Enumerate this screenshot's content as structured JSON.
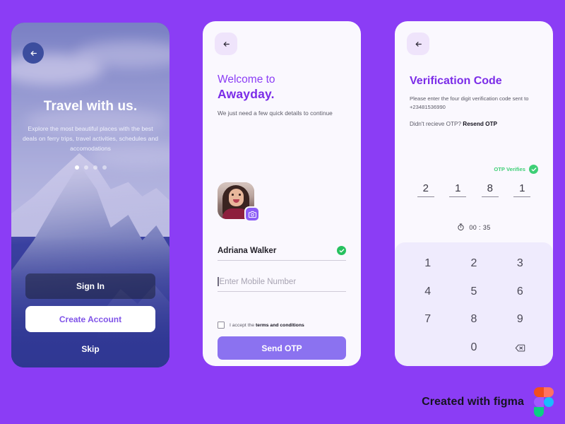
{
  "background_color": "#8B3DF5",
  "onboarding": {
    "back_icon": "arrow-left-icon",
    "title": "Travel with us.",
    "subtitle": "Explore the most beautiful places with the best deals on ferry trips, travel activities, schedules and accomodations",
    "pager": {
      "total": 4,
      "active_index": 0
    },
    "sign_in_label": "Sign In",
    "create_account_label": "Create Account",
    "skip_label": "Skip",
    "accent_create_account": "#8054E8"
  },
  "signup": {
    "back_icon": "arrow-left-icon",
    "welcome_line1": "Welcome to",
    "welcome_line2": "Awayday.",
    "note": "We just need a few quick details to continue",
    "avatar": {
      "name": "avatar",
      "camera_icon": "camera-icon"
    },
    "name_field": {
      "value": "Adriana Walker",
      "verified_icon": "check-badge-icon"
    },
    "phone_field": {
      "value": "",
      "placeholder": "Enter Mobile Number"
    },
    "terms": {
      "prefix": "I accept the ",
      "link": "terms and conditions",
      "checked": false
    },
    "submit_label": "Send OTP",
    "accent": "#8B72F0",
    "verified_color": "#27c15f"
  },
  "otp": {
    "back_icon": "arrow-left-icon",
    "title": "Verification Code",
    "instruction": "Please enter the four digit verification code sent to +23481536990",
    "resend_prefix": "Didn't recieve OTP? ",
    "resend_link": "Resend OTP",
    "status_text": "OTP Verifies",
    "status_icon": "check-badge-icon",
    "status_color": "#3ecf76",
    "digits": [
      "2",
      "1",
      "8",
      "1"
    ],
    "timer_icon": "stopwatch-icon",
    "timer": "00 : 35",
    "keypad": [
      "1",
      "2",
      "3",
      "4",
      "5",
      "6",
      "7",
      "8",
      "9",
      "",
      "0",
      "backspace-icon"
    ],
    "keypad_backspace_icon": "backspace-icon",
    "keypad_bg": "#EFEBFD"
  },
  "footer": {
    "text": "Created with figma",
    "logo_icon": "figma-logo-icon"
  }
}
